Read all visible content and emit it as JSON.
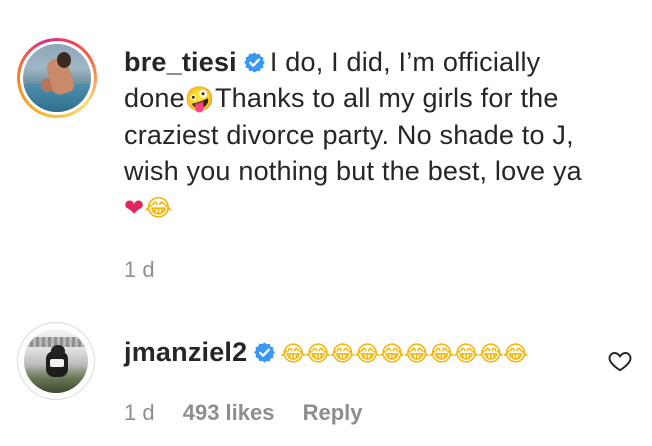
{
  "comments": [
    {
      "username": "bre_tiesi",
      "verified": true,
      "lines": [
        "I do, I did, I’m officially",
        "Thanks to all my girls for the",
        "craziest divorce party. No shade to J,",
        "wish you nothing but the best, love ya"
      ],
      "line2_prefix": "done",
      "emoji_zany": "🤪",
      "emoji_heart": "❤",
      "emoji_laugh": "😂",
      "time": "1 d"
    },
    {
      "username": "jmanziel2",
      "verified": true,
      "laugh_emojis": "😂😂😂😂😂😂😂😂😂😂",
      "time": "1 d",
      "likes": "493 likes",
      "reply": "Reply",
      "like_icon": "heart-outline-icon"
    }
  ],
  "colors": {
    "verified_badge": "#3897f0",
    "meta_text": "#8e8e8e",
    "text": "#262626"
  }
}
